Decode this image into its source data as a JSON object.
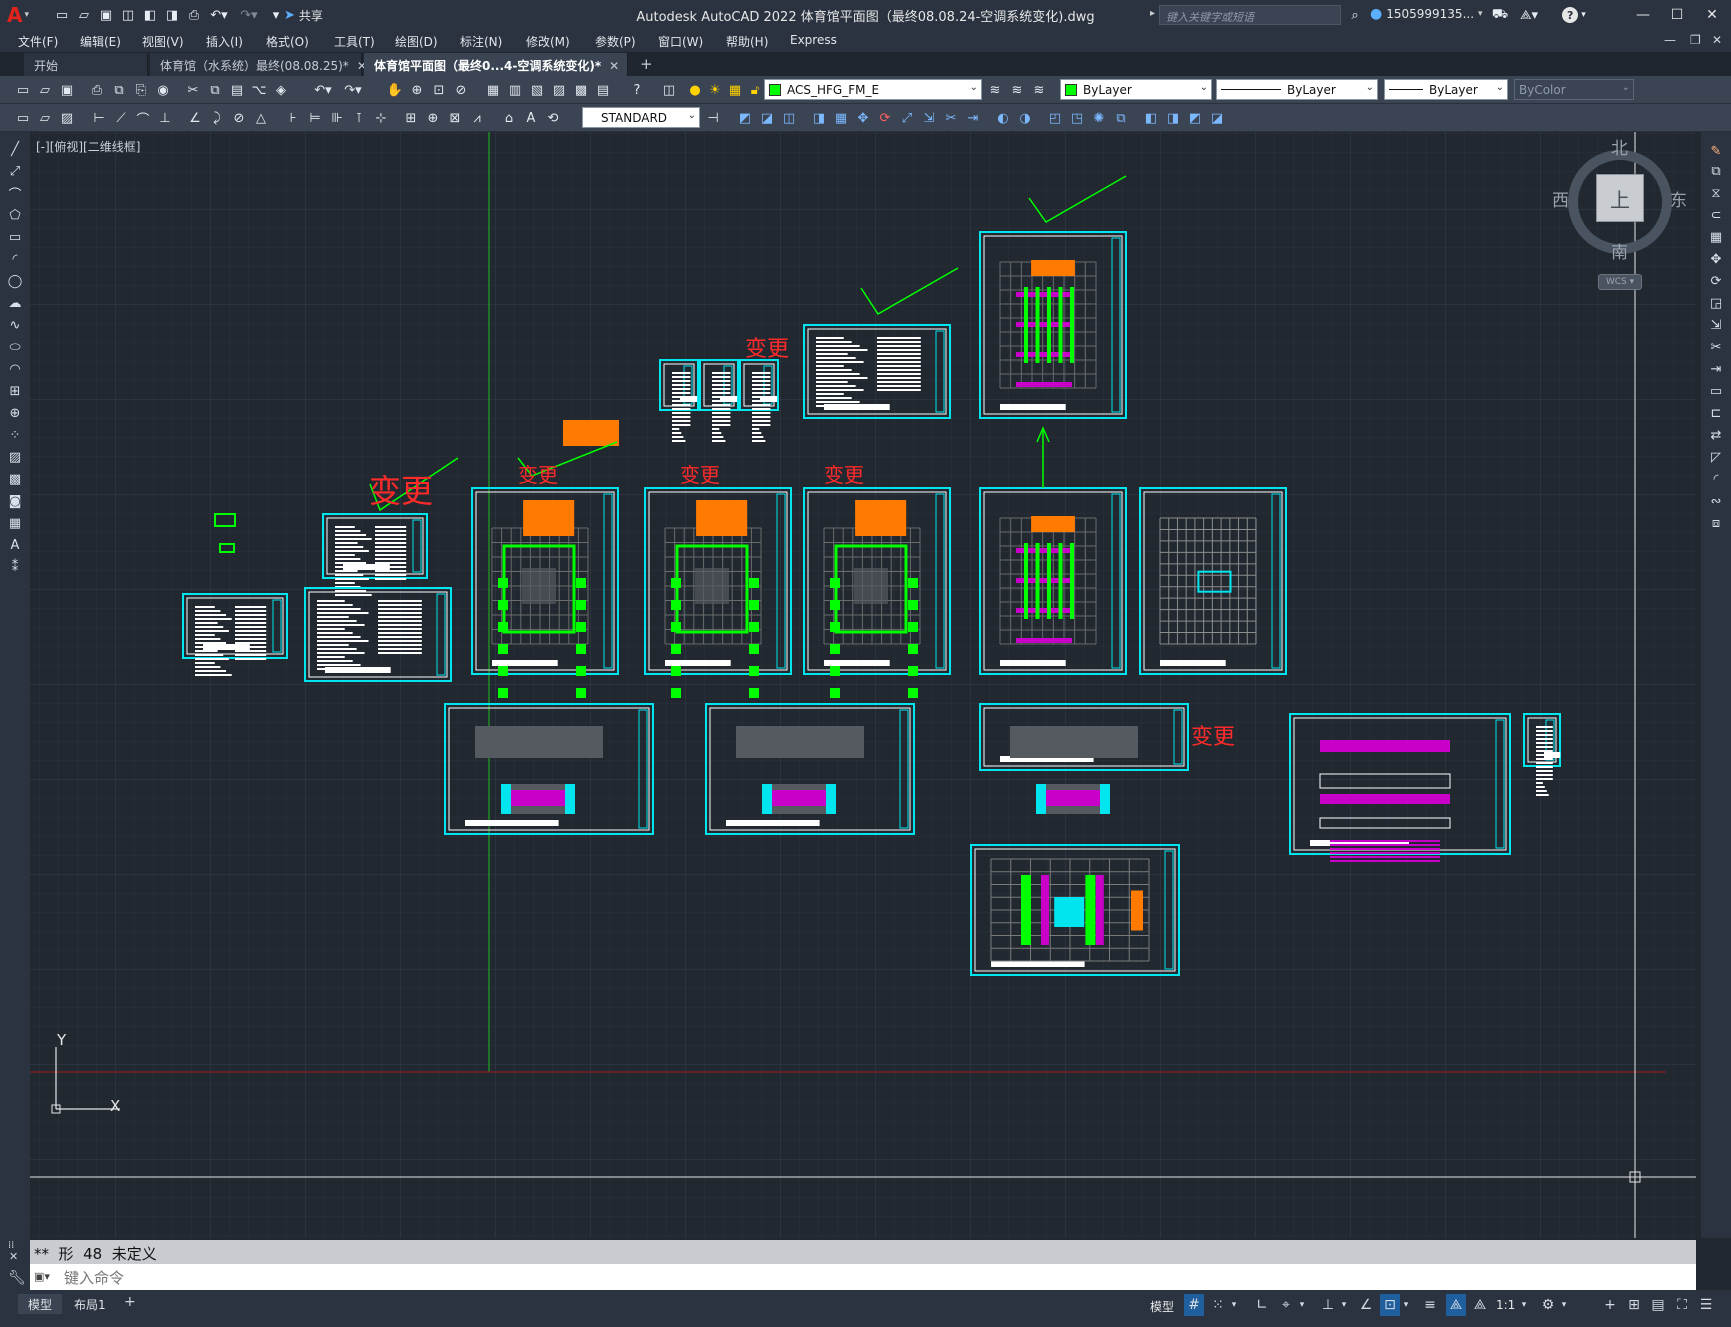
{
  "window": {
    "title": "Autodesk AutoCAD 2022    体育馆平面图（最终08.08.24-空调系统变化).dwg",
    "app_menu_glyph": "A",
    "share_label": "共享",
    "search_placeholder": "键入关键字或短语",
    "user_name": "1505999135...",
    "help_glyph": "?"
  },
  "menu": [
    "文件(F)",
    "编辑(E)",
    "视图(V)",
    "插入(I)",
    "格式(O)",
    "工具(T)",
    "绘图(D)",
    "标注(N)",
    "修改(M)",
    "参数(P)",
    "窗口(W)",
    "帮助(H)",
    "Express"
  ],
  "tabs": [
    {
      "label": "开始",
      "active": false,
      "closable": false
    },
    {
      "label": "体育馆（水系统）最终(08.08.25)*",
      "active": false,
      "closable": true
    },
    {
      "label": "体育馆平面图（最终0...4-空调系统变化)*",
      "active": true,
      "closable": true
    }
  ],
  "toolbar1": {
    "layer_combo": "ACS_HFG_FM_E",
    "color_combo": "ByLayer",
    "linetype_combo": "ByLayer",
    "lineweight_combo": "ByLayer",
    "plotstyle_combo": "ByColor"
  },
  "toolbar2": {
    "textstyle_combo": "STANDARD"
  },
  "viewport": {
    "label": "[-][俯视][二维线框]"
  },
  "viewcube": {
    "north": "北",
    "south": "南",
    "east": "东",
    "west": "西",
    "face": "上",
    "wcs": "WCS"
  },
  "ucs": {
    "x": "X",
    "y": "Y"
  },
  "markup": {
    "change_label": "变更"
  },
  "command": {
    "history": "**  形  48  未定义",
    "placeholder": "键入命令"
  },
  "layouts": [
    "模型",
    "布局1"
  ],
  "status": {
    "model": "模型",
    "scale": "1:1"
  },
  "colors": {
    "canvas": "#212830",
    "sheet_border": "#00e5ee",
    "plan_green": "#00ff00",
    "title_block_orange": "#ff7a00",
    "markup_red": "#ff2a2a",
    "duct_magenta": "#c800c8"
  }
}
